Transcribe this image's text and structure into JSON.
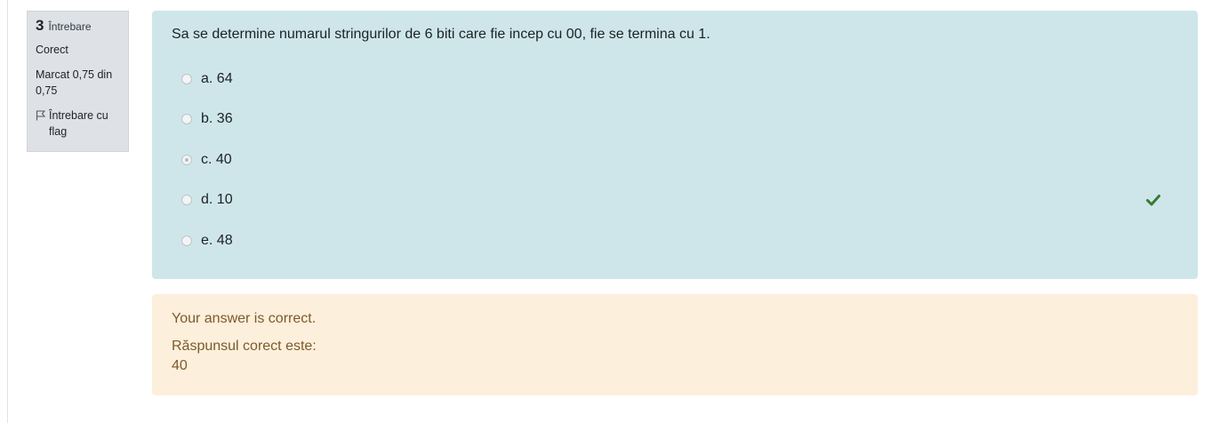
{
  "question_info": {
    "number": "3",
    "number_label": "Întrebare",
    "state": "Corect",
    "grade": "Marcat 0,75 din 0,75",
    "flag_label": "Întrebare cu flag"
  },
  "question": {
    "text": "Sa se determine numarul stringurilor de 6 biti care fie incep cu 00, fie se termina cu 1.",
    "options": [
      {
        "label": "a. 64",
        "selected": false
      },
      {
        "label": "b. 36",
        "selected": false
      },
      {
        "label": "c. 40",
        "selected": true
      },
      {
        "label": "d. 10",
        "selected": false
      },
      {
        "label": "e. 48",
        "selected": false
      }
    ],
    "correct_icon": "check-icon"
  },
  "feedback": {
    "result": "Your answer is correct.",
    "right_answer_label": "Răspunsul corect este:",
    "right_answer_value": "40"
  },
  "colors": {
    "info_bg": "#dee2e6",
    "formulation_bg": "#cee6ea",
    "feedback_bg": "#fcefdc",
    "feedback_text": "#7d5a29",
    "correct_green": "#357a32"
  }
}
